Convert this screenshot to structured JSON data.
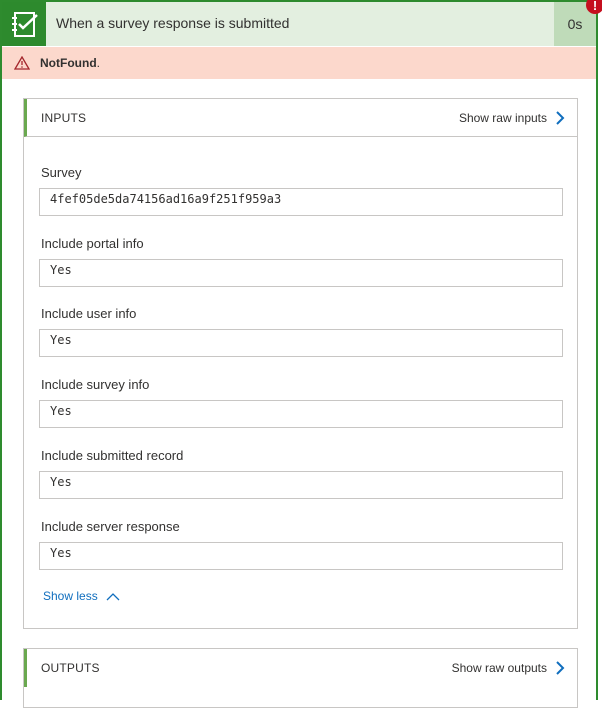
{
  "header": {
    "title": "When a survey response is submitted",
    "duration": "0s",
    "error_badge": "!"
  },
  "error": {
    "message": "NotFound",
    "suffix": "."
  },
  "inputs": {
    "title": "INPUTS",
    "raw_link": "Show raw inputs",
    "fields": [
      {
        "label": "Survey",
        "value": "4fef05de5da74156ad16a9f251f959a3"
      },
      {
        "label": "Include portal info",
        "value": "Yes"
      },
      {
        "label": "Include user info",
        "value": "Yes"
      },
      {
        "label": "Include survey info",
        "value": "Yes"
      },
      {
        "label": "Include submitted record",
        "value": "Yes"
      },
      {
        "label": "Include server response",
        "value": "Yes"
      }
    ],
    "show_less": "Show less"
  },
  "outputs": {
    "title": "OUTPUTS",
    "raw_link": "Show raw outputs"
  },
  "colors": {
    "success_green": "#2d8a2d",
    "header_bg": "#e3efe0",
    "error_bg": "#fcd8cc",
    "link_blue": "#106ebe"
  }
}
